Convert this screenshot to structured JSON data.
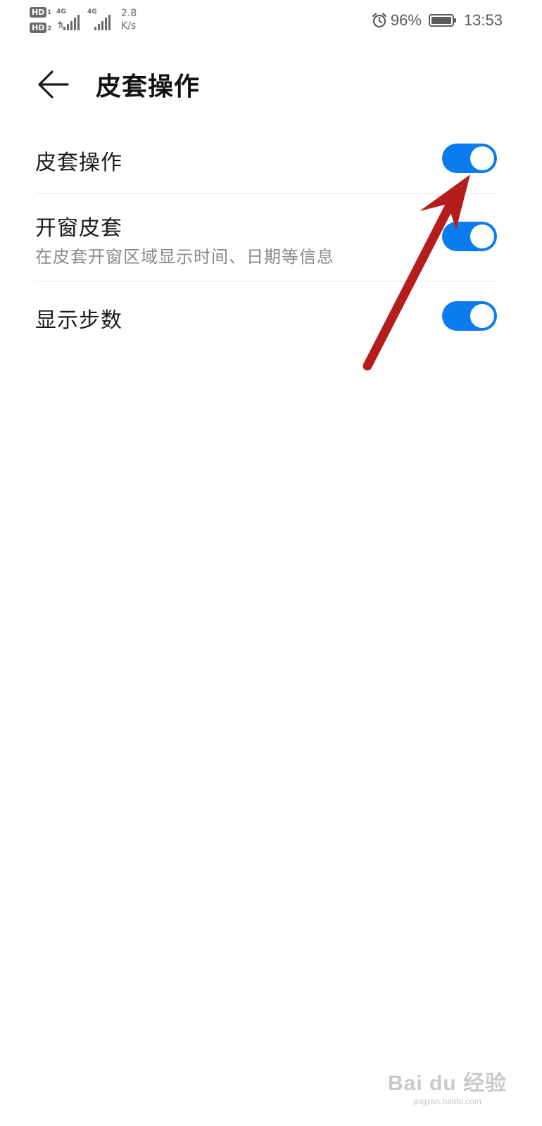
{
  "status_bar": {
    "hd1": "HD",
    "hd1_slot": "1",
    "hd2": "HD",
    "hd2_slot": "2",
    "network1": "4G",
    "network2": "4G",
    "rate_value": "2.8",
    "rate_unit": "K/s",
    "battery_percent": "96%",
    "time": "13:53"
  },
  "header": {
    "title": "皮套操作"
  },
  "settings": [
    {
      "title": "皮套操作",
      "subtitle": "",
      "enabled": true
    },
    {
      "title": "开窗皮套",
      "subtitle": "在皮套开窗区域显示时间、日期等信息",
      "enabled": true
    },
    {
      "title": "显示步数",
      "subtitle": "",
      "enabled": true
    }
  ],
  "watermark": {
    "logo_text": "Bai du 经验",
    "url": "jingyan.baidu.com"
  },
  "colors": {
    "toggle_on": "#0a7cf0",
    "arrow": "#b51c1c"
  },
  "icons": [
    "back-arrow-icon",
    "alarm-icon",
    "battery-icon",
    "signal-icon"
  ]
}
